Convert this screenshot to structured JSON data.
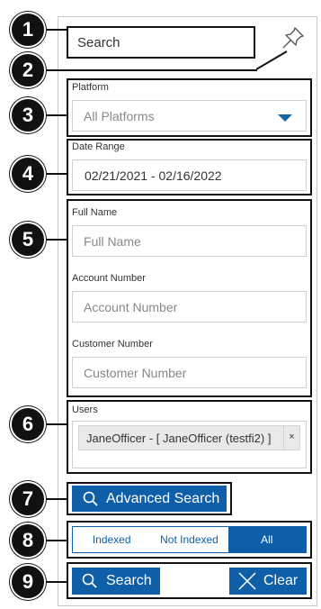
{
  "callouts": [
    "1",
    "2",
    "3",
    "4",
    "5",
    "6",
    "7",
    "8",
    "9"
  ],
  "header": {
    "title": "Search"
  },
  "platform": {
    "label": "Platform",
    "selected": "All Platforms"
  },
  "date_range": {
    "label": "Date Range",
    "value": "02/21/2021 - 02/16/2022"
  },
  "full_name": {
    "label": "Full Name",
    "placeholder": "Full Name"
  },
  "account_number": {
    "label": "Account Number",
    "placeholder": "Account Number"
  },
  "customer_number": {
    "label": "Customer Number",
    "placeholder": "Customer Number"
  },
  "users": {
    "label": "Users",
    "selected": [
      "JaneOfficer - [ JaneOfficer (testfi2) ]"
    ],
    "remove_glyph": "×"
  },
  "advanced_search": {
    "label": "Advanced Search",
    "icon": "search-icon"
  },
  "index_filter": {
    "options": [
      "Indexed",
      "Not Indexed",
      "All"
    ],
    "active": "All"
  },
  "actions": {
    "search_label": "Search",
    "clear_label": "Clear"
  },
  "colors": {
    "accent": "#0f5ea8",
    "callout": "#111111"
  }
}
